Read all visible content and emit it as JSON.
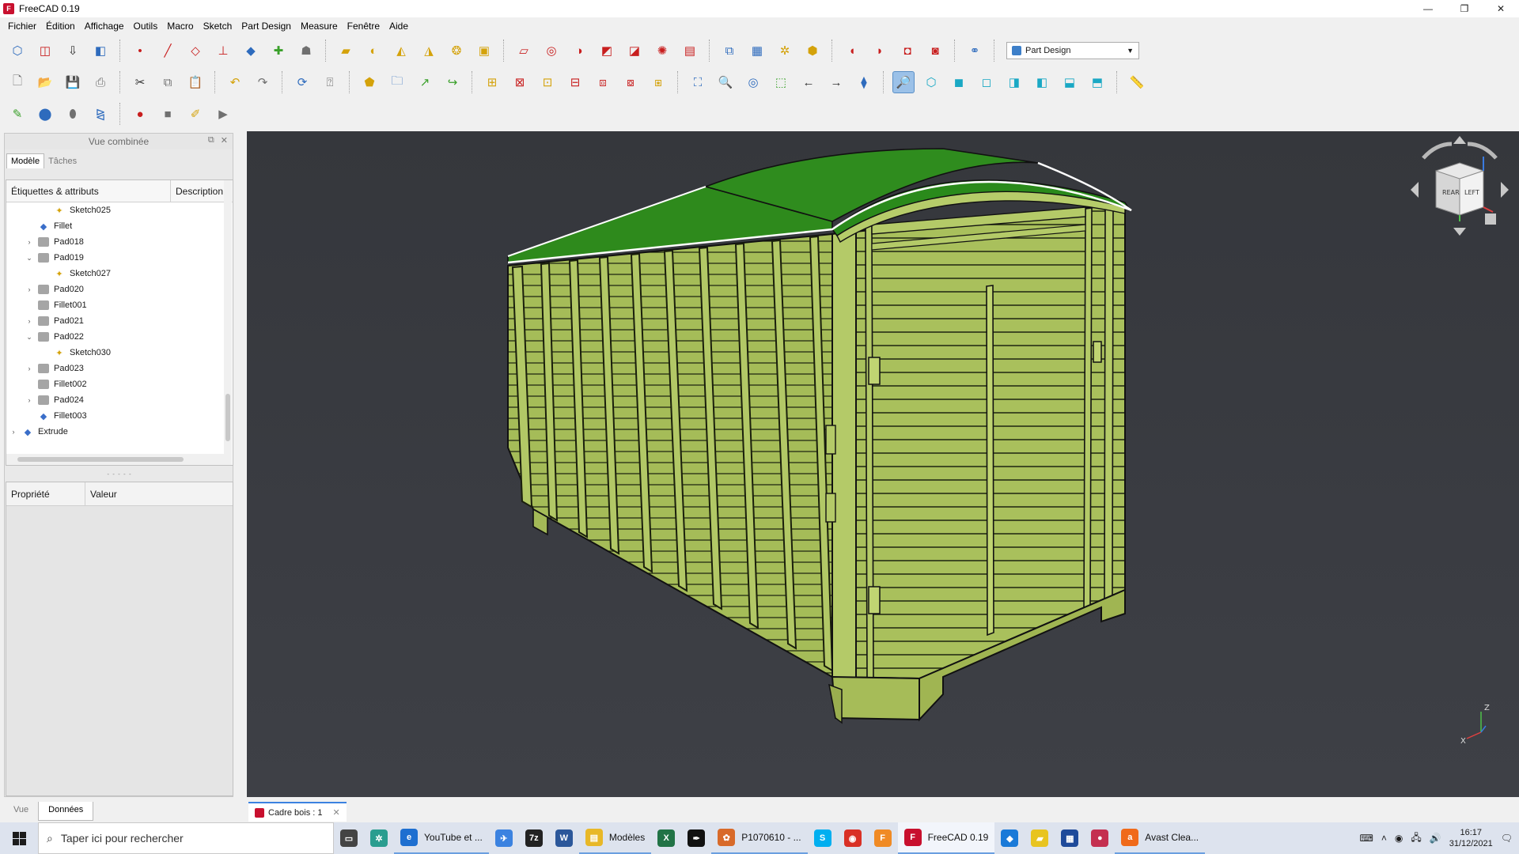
{
  "window": {
    "title": "FreeCAD 0.19"
  },
  "menu": [
    "Fichier",
    "Édition",
    "Affichage",
    "Outils",
    "Macro",
    "Sketch",
    "Part Design",
    "Measure",
    "Fenêtre",
    "Aide"
  ],
  "toolbar": {
    "workbench": "Part Design"
  },
  "combo": {
    "title": "Vue combinée",
    "tabs": [
      "Modèle",
      "Tâches"
    ],
    "tree_headers": [
      "Étiquettes & attributs",
      "Description"
    ],
    "tree_items": [
      {
        "label": "Sketch025",
        "icon": "sketch-icon",
        "level": 2,
        "expander": ""
      },
      {
        "label": "Fillet",
        "icon": "fillet-icon",
        "level": 1,
        "expander": ""
      },
      {
        "label": "Pad018",
        "icon": "pad-icon",
        "level": 1,
        "expander": "›"
      },
      {
        "label": "Pad019",
        "icon": "pad-icon",
        "level": 1,
        "expander": "⌄"
      },
      {
        "label": "Sketch027",
        "icon": "sketch-icon",
        "level": 2,
        "expander": ""
      },
      {
        "label": "Pad020",
        "icon": "pad-icon",
        "level": 1,
        "expander": "›"
      },
      {
        "label": "Fillet001",
        "icon": "pad-icon",
        "level": 1,
        "expander": ""
      },
      {
        "label": "Pad021",
        "icon": "pad-icon",
        "level": 1,
        "expander": "›"
      },
      {
        "label": "Pad022",
        "icon": "pad-icon",
        "level": 1,
        "expander": "⌄"
      },
      {
        "label": "Sketch030",
        "icon": "sketch-icon",
        "level": 2,
        "expander": ""
      },
      {
        "label": "Pad023",
        "icon": "pad-icon",
        "level": 1,
        "expander": "›"
      },
      {
        "label": "Fillet002",
        "icon": "pad-icon",
        "level": 1,
        "expander": ""
      },
      {
        "label": "Pad024",
        "icon": "pad-icon",
        "level": 1,
        "expander": "›"
      },
      {
        "label": "Fillet003",
        "icon": "fillet-icon",
        "level": 1,
        "expander": ""
      },
      {
        "label": "Extrude",
        "icon": "extrude-icon",
        "level": 0,
        "expander": "›"
      }
    ],
    "prop_headers": [
      "Propriété",
      "Valeur"
    ],
    "bottom_tabs": [
      "Vue",
      "Données"
    ]
  },
  "document_tab": {
    "label": "Cadre bois : 1"
  },
  "navcube": {
    "face_left": "REAR",
    "face_right": "LEFT",
    "axes": [
      "Z",
      "X",
      "Y"
    ]
  },
  "taskbar": {
    "search_placeholder": "Taper ici pour rechercher",
    "apps": [
      {
        "name": "task-view",
        "label": ""
      },
      {
        "name": "pinwheel-app",
        "label": ""
      },
      {
        "name": "edge-youtube",
        "label": "YouTube et ..."
      },
      {
        "name": "mail-app",
        "label": ""
      },
      {
        "name": "7zip-app",
        "label": ""
      },
      {
        "name": "word-app",
        "label": ""
      },
      {
        "name": "explorer-modeles",
        "label": "Modèles"
      },
      {
        "name": "excel-app",
        "label": ""
      },
      {
        "name": "inkscape-app",
        "label": ""
      },
      {
        "name": "photo-app",
        "label": "P1070610 - ..."
      },
      {
        "name": "skype-app",
        "label": ""
      },
      {
        "name": "chrome-app",
        "label": ""
      },
      {
        "name": "f-app",
        "label": ""
      },
      {
        "name": "freecad-app",
        "label": "FreeCAD 0.19"
      },
      {
        "name": "diamond-app",
        "label": ""
      },
      {
        "name": "sticky-app",
        "label": ""
      },
      {
        "name": "calculator-app",
        "label": ""
      },
      {
        "name": "berry-app",
        "label": ""
      },
      {
        "name": "avast-app",
        "label": "Avast Clea..."
      }
    ],
    "time": "16:17",
    "date": "31/12/2021"
  },
  "colors": {
    "roof": "#2f8a1f",
    "body": "#a7be5a",
    "viewport_bg": "#3a3c42",
    "accent": "#3b82e0"
  }
}
